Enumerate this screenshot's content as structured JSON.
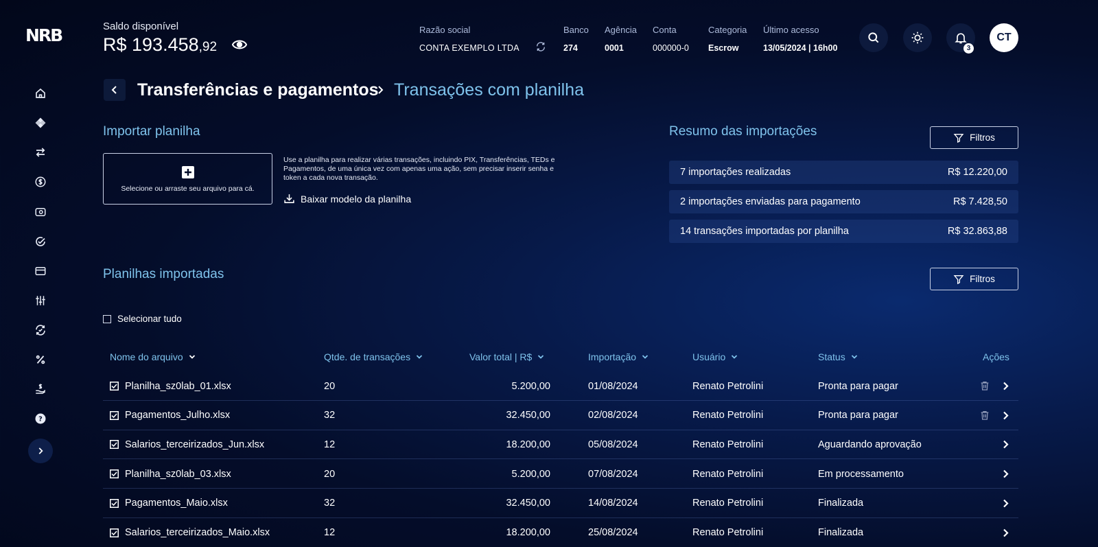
{
  "header": {
    "logo": "NRB",
    "balance_label": "Saldo disponível",
    "balance_main": "R$ 193.458",
    "balance_cents": ",92",
    "razao_social_label": "Razão social",
    "razao_social_value": "CONTA EXEMPLO LTDA",
    "banco_label": "Banco",
    "banco_value": "274",
    "agencia_label": "Agência",
    "agencia_value": "0001",
    "conta_label": "Conta",
    "conta_value": "000000-0",
    "categoria_label": "Categoria",
    "categoria_value": "Escrow",
    "ultimo_acesso_label": "Último acesso",
    "ultimo_acesso_value": "13/05/2024 | 16h00",
    "notification_count": "3",
    "avatar_initials": "CT"
  },
  "sidebar": {
    "items": [
      {
        "icon": "home-icon"
      },
      {
        "icon": "pix-icon"
      },
      {
        "icon": "transfer-icon"
      },
      {
        "icon": "dollar-icon"
      },
      {
        "icon": "wallet-icon"
      },
      {
        "icon": "check-circle-icon"
      },
      {
        "icon": "card-icon"
      },
      {
        "icon": "sliders-icon"
      },
      {
        "icon": "refresh-icon"
      },
      {
        "icon": "percent-icon"
      },
      {
        "icon": "hand-money-icon"
      },
      {
        "icon": "help-icon"
      }
    ]
  },
  "breadcrumb": {
    "parent": "Transferências e pagamentos",
    "current": "Transações com planilha"
  },
  "import": {
    "title": "Importar planilha",
    "dropzone_text": "Selecione ou arraste seu arquivo para cá.",
    "description": "Use a planilha para realizar várias transações, incluindo PIX, Transferências, TEDs e Pagamentos, de uma única vez com apenas uma ação, sem precisar inserir senha e token a cada nova transação.",
    "download_label": "Baixar modelo da planilha"
  },
  "summary": {
    "title": "Resumo das importações",
    "filter_label": "Filtros",
    "rows": [
      {
        "label": "7 importações realizadas",
        "value": "R$ 12.220,00"
      },
      {
        "label": "2 importações enviadas para pagamento",
        "value": "R$ 7.428,50"
      },
      {
        "label": "14 transações importadas por planilha",
        "value": "R$ 32.863,88"
      }
    ]
  },
  "imported": {
    "title": "Planilhas importadas",
    "filter_label": "Filtros",
    "select_all_label": "Selecionar tudo",
    "columns": {
      "file": "Nome do arquivo",
      "count": "Qtde. de transações",
      "total": "Valor total | R$",
      "date": "Importação",
      "user": "Usuário",
      "status": "Status",
      "actions": "Ações"
    },
    "rows": [
      {
        "file": "Planilha_sz0lab_01.xlsx",
        "count": "20",
        "total": "5.200,00",
        "date": "01/08/2024",
        "user": "Renato Petrolini",
        "status": "Pronta para pagar",
        "deletable": true
      },
      {
        "file": "Pagamentos_Julho.xlsx",
        "count": "32",
        "total": "32.450,00",
        "date": "02/08/2024",
        "user": "Renato Petrolini",
        "status": "Pronta para pagar",
        "deletable": true
      },
      {
        "file": "Salarios_terceirizados_Jun.xlsx",
        "count": "12",
        "total": "18.200,00",
        "date": "05/08/2024",
        "user": "Renato Petrolini",
        "status": "Aguardando aprovação",
        "deletable": false
      },
      {
        "file": "Planilha_sz0lab_03.xlsx",
        "count": "20",
        "total": "5.200,00",
        "date": "07/08/2024",
        "user": "Renato Petrolini",
        "status": "Em processamento",
        "deletable": false
      },
      {
        "file": "Pagamentos_Maio.xlsx",
        "count": "32",
        "total": "32.450,00",
        "date": "14/08/2024",
        "user": "Renato Petrolini",
        "status": "Finalizada",
        "deletable": false
      },
      {
        "file": "Salarios_terceirizados_Maio.xlsx",
        "count": "12",
        "total": "18.200,00",
        "date": "25/08/2024",
        "user": "Renato Petrolini",
        "status": "Finalizada",
        "deletable": false
      }
    ]
  },
  "colors": {
    "accent": "#7fc3ec",
    "background": "#040d2a"
  }
}
